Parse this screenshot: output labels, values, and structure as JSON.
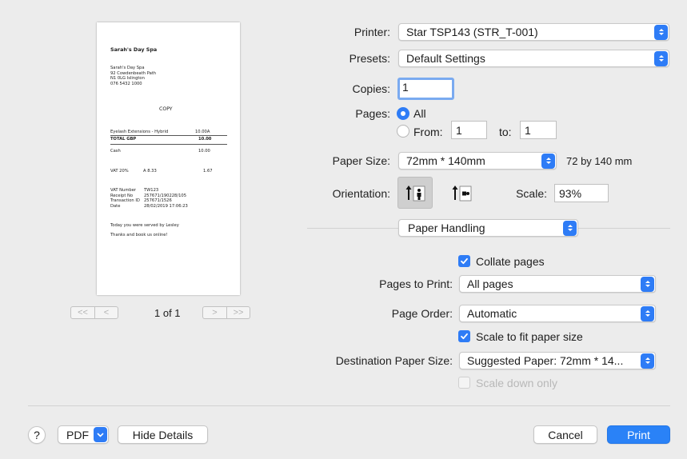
{
  "preview": {
    "shop_title": "Sarah's Day Spa",
    "address": [
      "Sarah's Day Spa",
      "92 Cowdenbeath Path",
      "N1 0LG Islington",
      "076 5432 1000"
    ],
    "copy_label": "COPY",
    "item": {
      "name": "Eyelash Extensions - Hybrid",
      "price": "10.00A"
    },
    "total": {
      "label": "TOTAL GBP",
      "value": "10.00"
    },
    "cash": {
      "label": "Cash",
      "value": "10.00"
    },
    "vat": {
      "label": "VAT 20%",
      "base": "A 8.33",
      "value": "1.67"
    },
    "details": [
      {
        "label": "VAT Number",
        "value": "TW123"
      },
      {
        "label": "Receipt No",
        "value": "257671/190228/105"
      },
      {
        "label": "Transaction ID",
        "value": "257671/1526"
      },
      {
        "label": "Date",
        "value": "28/02/2019 17:06:23"
      }
    ],
    "footer": [
      "Today you were served by Lesley",
      "Thanks and book us online!"
    ],
    "nav": {
      "first": "<<",
      "prev": "<",
      "next": ">",
      "last": ">>"
    },
    "page_indicator": "1 of 1"
  },
  "printer": {
    "label": "Printer:",
    "value": "Star TSP143 (STR_T-001)"
  },
  "presets": {
    "label": "Presets:",
    "value": "Default Settings"
  },
  "copies": {
    "label": "Copies:",
    "value": "1"
  },
  "pages": {
    "label": "Pages:",
    "all_label": "All",
    "from_label": "From:",
    "from_value": "1",
    "to_label": "to:",
    "to_value": "1",
    "selected": "All"
  },
  "paper_size": {
    "label": "Paper Size:",
    "value": "72mm * 140mm",
    "dimensions": "72 by 140 mm"
  },
  "orientation": {
    "label": "Orientation:",
    "selected": "portrait"
  },
  "scale": {
    "label": "Scale:",
    "value": "93%"
  },
  "section": {
    "value": "Paper Handling"
  },
  "collate": {
    "label": "Collate pages",
    "checked": true
  },
  "pages_to_print": {
    "label": "Pages to Print:",
    "value": "All pages"
  },
  "page_order": {
    "label": "Page Order:",
    "value": "Automatic"
  },
  "scale_to_fit": {
    "label": "Scale to fit paper size",
    "checked": true
  },
  "destination": {
    "label": "Destination Paper Size:",
    "value": "Suggested Paper: 72mm * 14..."
  },
  "scale_down": {
    "label": "Scale down only",
    "checked": false,
    "enabled": false
  },
  "footer": {
    "help": "?",
    "pdf": "PDF",
    "hide_details": "Hide Details",
    "cancel": "Cancel",
    "print": "Print"
  },
  "colors": {
    "accent": "#2E7CF6",
    "print_button": "#2A82F7",
    "window_bg": "#ECECEC"
  }
}
